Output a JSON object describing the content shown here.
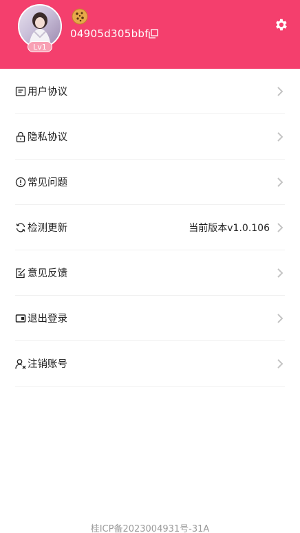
{
  "header": {
    "user_id": "04905d305bbf",
    "level": "Lv1",
    "background_color": "#f43f6d",
    "icons": [
      "cookie-icon",
      "copy-icon",
      "gear-icon"
    ]
  },
  "menu": {
    "items": [
      {
        "label": "用户协议",
        "icon": "document-icon"
      },
      {
        "label": "隐私协议",
        "icon": "lock-icon"
      },
      {
        "label": "常见问题",
        "icon": "info-icon"
      },
      {
        "label": "检测更新",
        "icon": "refresh-icon",
        "value": "当前版本v1.0.106"
      },
      {
        "label": "意见反馈",
        "icon": "feedback-icon"
      },
      {
        "label": "退出登录",
        "icon": "logout-icon"
      },
      {
        "label": "注销账号",
        "icon": "user-remove-icon"
      }
    ]
  },
  "footer": {
    "icp": "桂ICP备2023004931号-31A"
  }
}
